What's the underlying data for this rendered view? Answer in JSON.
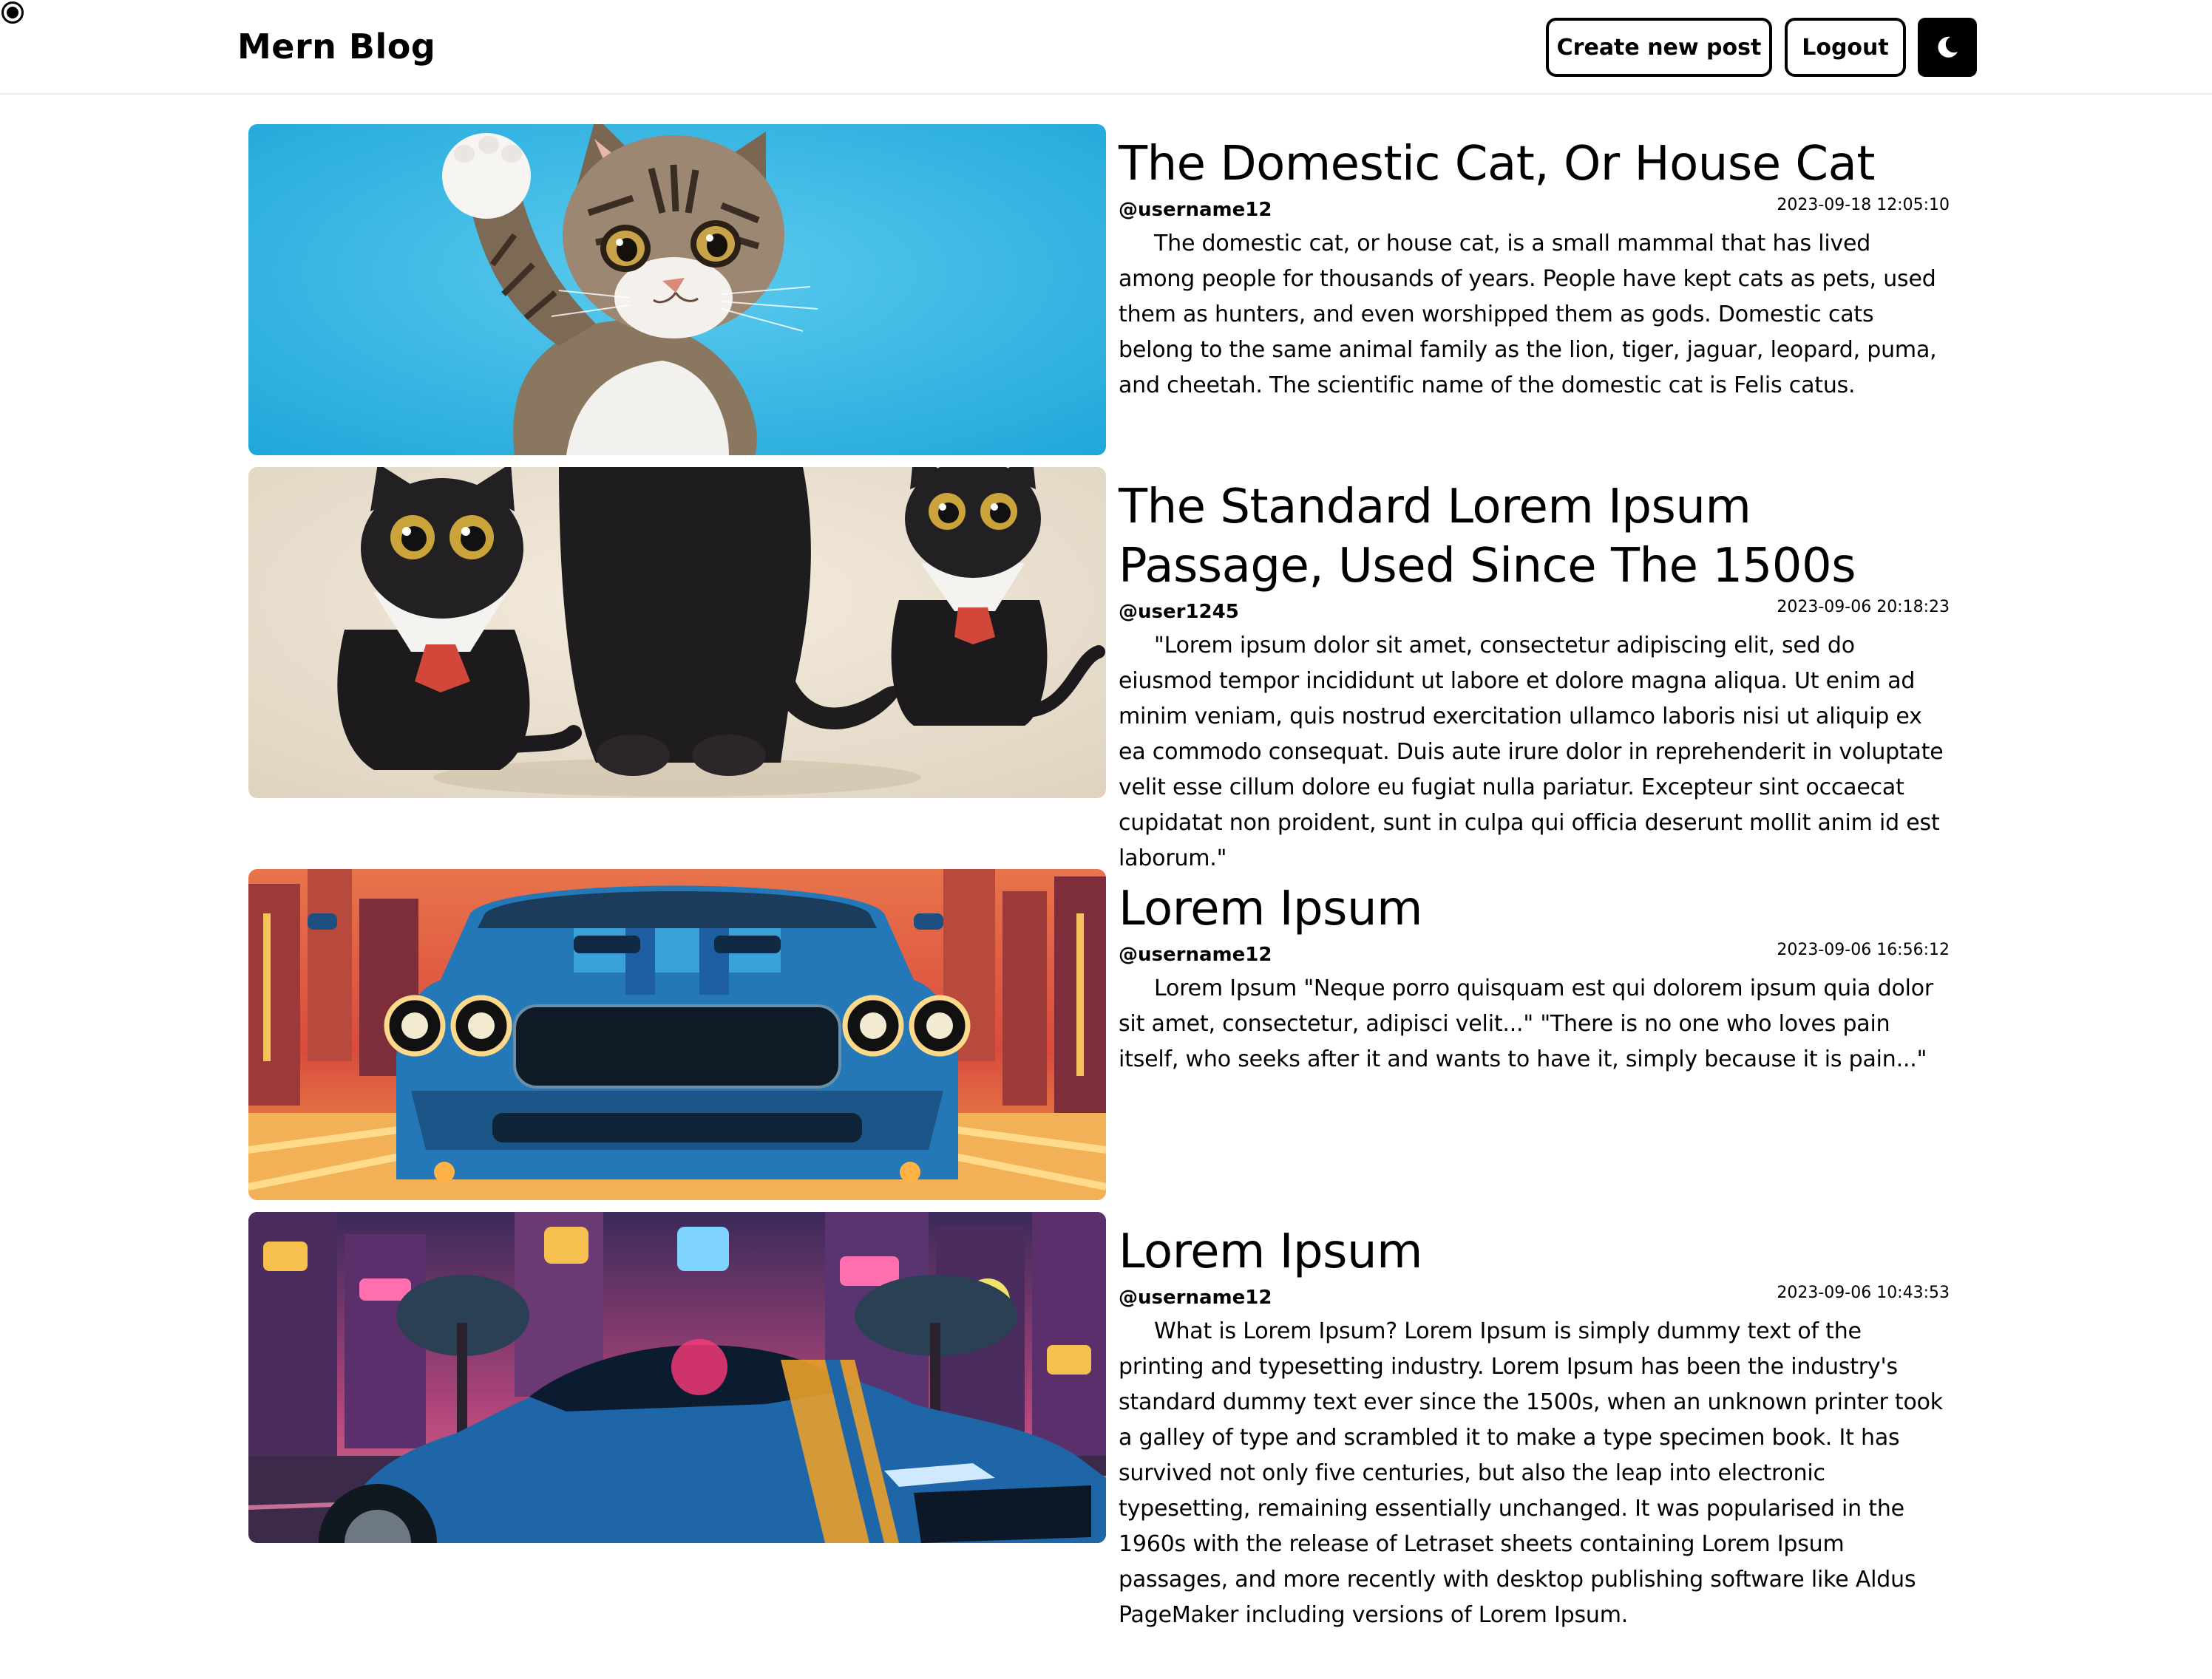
{
  "header": {
    "brand": "Mern Blog",
    "create_label": "Create new post",
    "logout_label": "Logout",
    "theme_icon": "moon-icon"
  },
  "posts": [
    {
      "title": "The Domestic Cat, Or House Cat",
      "author": "@username12",
      "date": "2023-09-18 12:05:10",
      "summary": "The domestic cat, or house cat, is a small mammal that has lived among people for thousands of years. People have kept cats as pets, used them as hunters, and even worshipped them as gods. Domestic cats belong to the same animal family as the lion, tiger, jaguar, leopard, puma, and cheetah. The scientific name of the domestic cat is Felis catus."
    },
    {
      "title": "The Standard Lorem Ipsum Passage, Used Since The 1500s",
      "author": "@user1245",
      "date": "2023-09-06 20:18:23",
      "summary": "\"Lorem ipsum dolor sit amet, consectetur adipiscing elit, sed do eiusmod tempor incididunt ut labore et dolore magna aliqua. Ut enim ad minim veniam, quis nostrud exercitation ullamco laboris nisi ut aliquip ex ea commodo consequat. Duis aute irure dolor in reprehenderit in voluptate velit esse cillum dolore eu fugiat nulla pariatur. Excepteur sint occaecat cupidatat non proident, sunt in culpa qui officia deserunt mollit anim id est laborum.\""
    },
    {
      "title": "Lorem Ipsum",
      "author": "@username12",
      "date": "2023-09-06 16:56:12",
      "summary": "Lorem Ipsum \"Neque porro quisquam est qui dolorem ipsum quia dolor sit amet, consectetur, adipisci velit...\" \"There is no one who loves pain itself, who seeks after it and wants to have it, simply because it is pain...\""
    },
    {
      "title": "Lorem Ipsum",
      "author": "@username12",
      "date": "2023-09-06 10:43:53",
      "summary": "What is Lorem Ipsum? Lorem Ipsum is simply dummy text of the printing and typesetting industry. Lorem Ipsum has been the industry's standard dummy text ever since the 1500s, when an unknown printer took a galley of type and scrambled it to make a type specimen book. It has survived not only five centuries, but also the leap into electronic typesetting, remaining essentially unchanged. It was popularised in the 1960s with the release of Letraset sheets containing Lorem Ipsum passages, and more recently with desktop publishing software like Aldus PageMaker including versions of Lorem Ipsum."
    }
  ]
}
